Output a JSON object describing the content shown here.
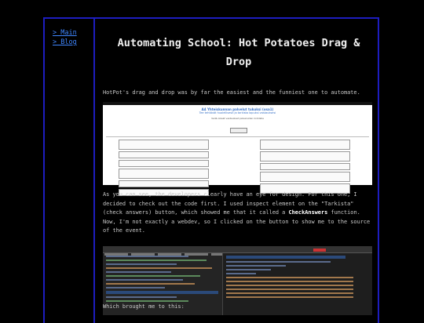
{
  "nav": {
    "main": "> Main",
    "blog": "> Blog"
  },
  "post": {
    "title": "Automating School: Hot Potatoes Drag & Drop",
    "p1": "HotPot's drag and drop was by far the easiest and the funniest one to automate.",
    "p2_pre": "As you can see, the developers clearly have an eye for design. For this one, I decided to check out the code first. I used inspect element on the \"Tarkista\" (check answers) button, which showed me that it called a ",
    "p2_kw": "CheckAnswers",
    "p2_post": " function. Now, I'm not exactly a webdev, so I clicked on the button to show me to the source of the event.",
    "p3": "Which brought me to this:"
  },
  "screenshot1": {
    "heading": "A4 Yhteiskunnan palvelut tukuksi (osa1)",
    "subheading": "Tee tehtävät huolellisesti ja tarkista lopuksi vastauksesi",
    "instruction": "Vedä oikeat vastaukset palveluiden kohdalle"
  }
}
